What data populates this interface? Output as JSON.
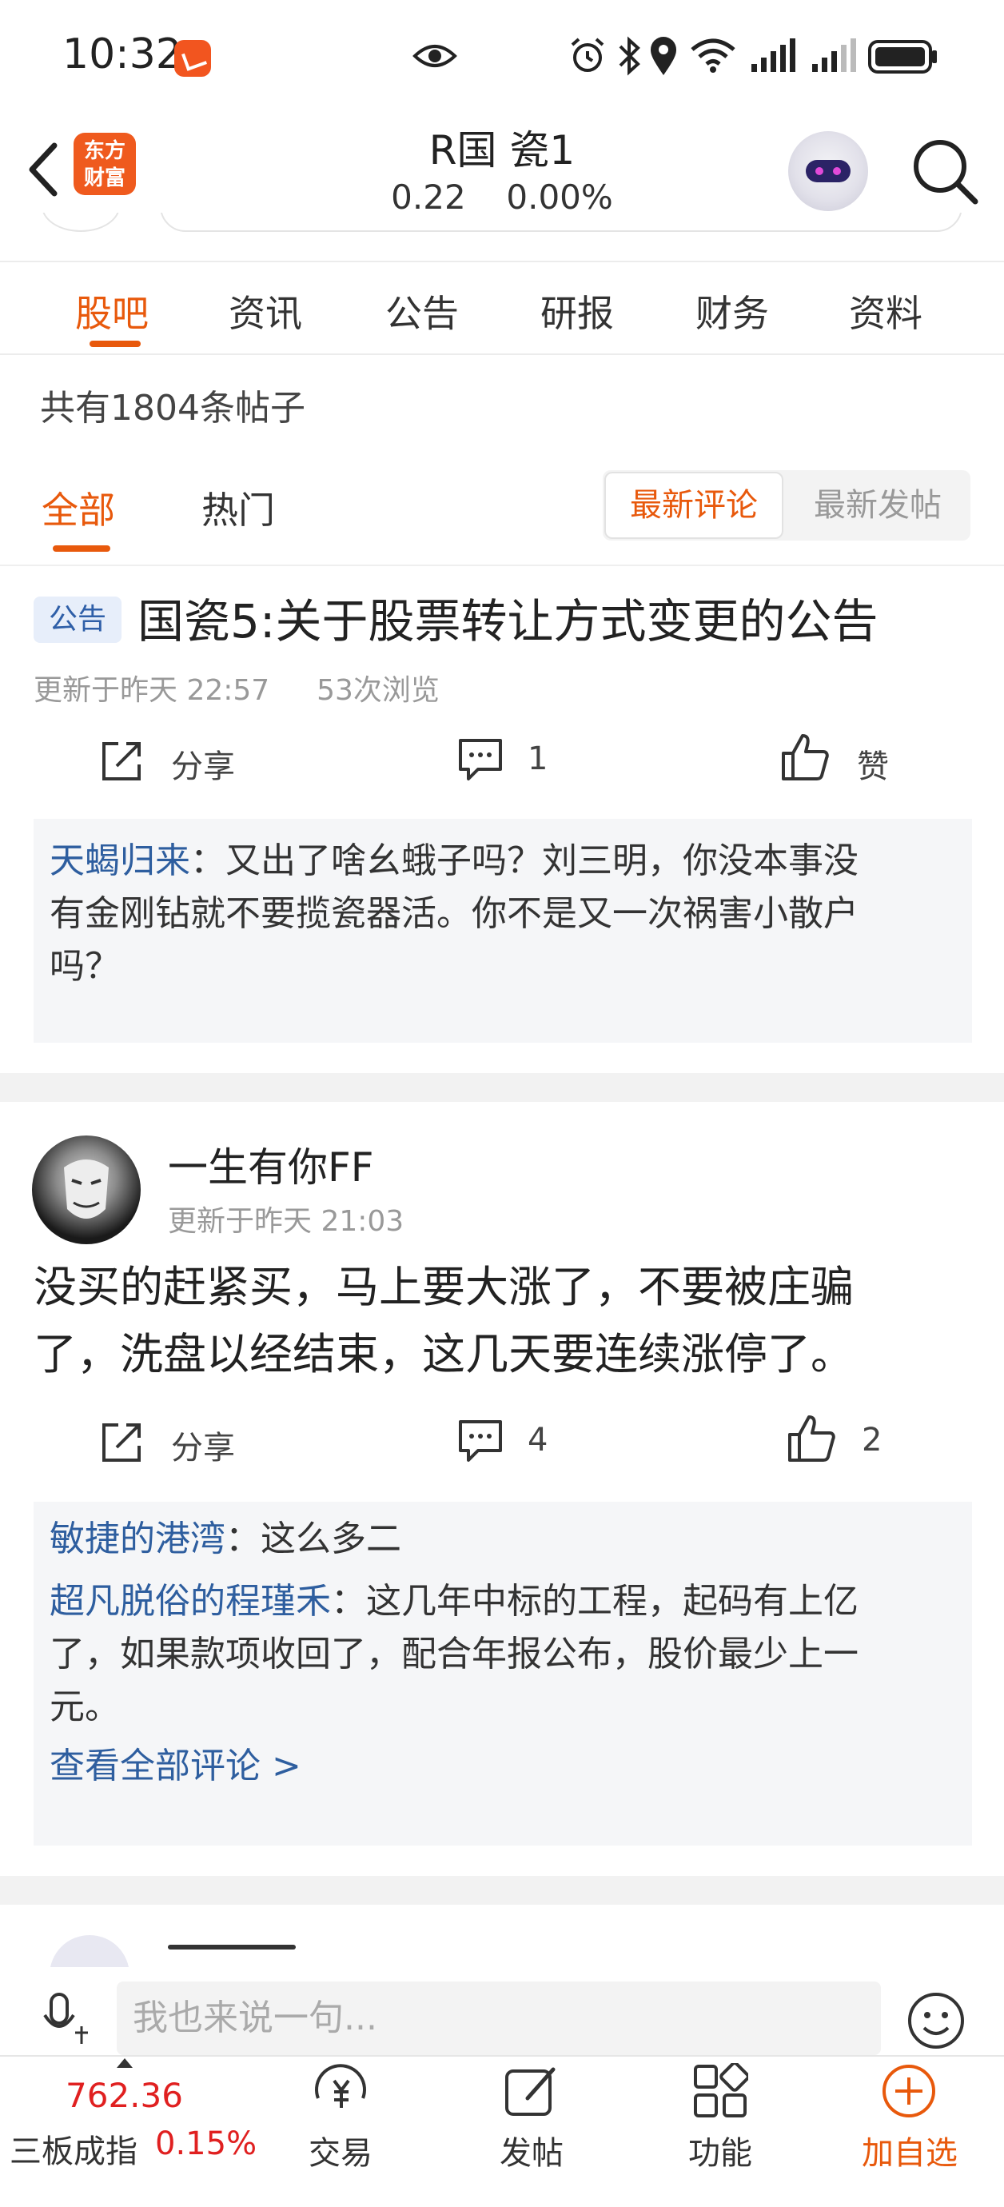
{
  "status_bar": {
    "time": "10:32"
  },
  "header": {
    "title": "R国  瓷1",
    "price": "0.22",
    "change": "0.00%",
    "logo_line1": "东方",
    "logo_line2": "财富"
  },
  "tabs": [
    "股吧",
    "资讯",
    "公告",
    "研报",
    "财务",
    "资料"
  ],
  "post_count": "共有1804条帖子",
  "filter_tabs": [
    "全部",
    "热门"
  ],
  "sort_options": {
    "active": "最新评论",
    "other": "最新发帖"
  },
  "post1": {
    "badge": "公告",
    "title": "国瓷5:关于股票转让方式变更的公告",
    "updated": "更新于昨天 22:57",
    "views": "53次浏览",
    "share": "分享",
    "comments": "1",
    "like": "赞",
    "reply_user": "天蝎归来",
    "reply_line1": "：又出了啥幺蛾子吗？刘三明，你没本事没",
    "reply_line2": "有金刚钻就不要揽瓷器活。你不是又一次祸害小散户",
    "reply_line3": "吗？"
  },
  "post2": {
    "author": "一生有你FF",
    "updated": "更新于昨天 21:03",
    "body_line1": "没买的赶紧买，马上要大涨了，不要被庄骗",
    "body_line2": "了，洗盘以经结束，这几天要连续涨停了。",
    "share": "分享",
    "comments": "4",
    "likes": "2",
    "reply1_user": "敏捷的港湾",
    "reply1_text": "：这么多二",
    "reply2_user": "超凡脱俗的程瑾禾",
    "reply2_line1": "：这几年中标的工程，起码有上亿",
    "reply2_line2": "了，如果款项收回了，配合年报公布，股价最少上一",
    "reply2_line3": "元。",
    "view_all": "查看全部评论 >"
  },
  "input": {
    "placeholder": "我也来说一句..."
  },
  "bottom_tabs": {
    "index_value": "762.36",
    "index_name": "三板成指",
    "index_change": "0.15%",
    "trade": "交易",
    "post": "发帖",
    "function": "功能",
    "add_watch": "加自选"
  },
  "colors": {
    "accent": "#e8590c",
    "link": "#2e5e9f",
    "up": "#e02020"
  },
  "icons": [
    "back-icon",
    "search-icon",
    "share-icon",
    "comment-icon",
    "like-icon",
    "voice-icon",
    "smile-icon",
    "trade-icon",
    "post-icon",
    "function-icon",
    "add-icon"
  ]
}
